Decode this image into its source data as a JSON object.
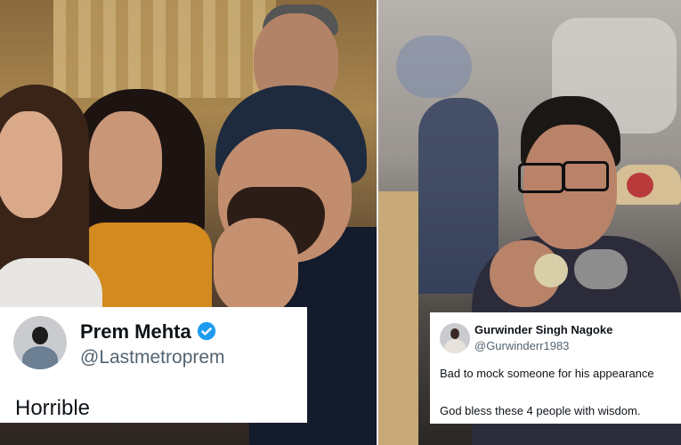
{
  "left_tweet": {
    "name": "Prem Mehta",
    "handle": "@Lastmetroprem",
    "text": "Horrible",
    "verified_color": "#1d9bf0"
  },
  "right_tweet": {
    "name": "Gurwinder Singh Nagoke",
    "handle": "@Gurwinderr1983",
    "line1": "Bad to mock someone for his appearance",
    "line2": "God bless these 4 people with wisdom."
  }
}
